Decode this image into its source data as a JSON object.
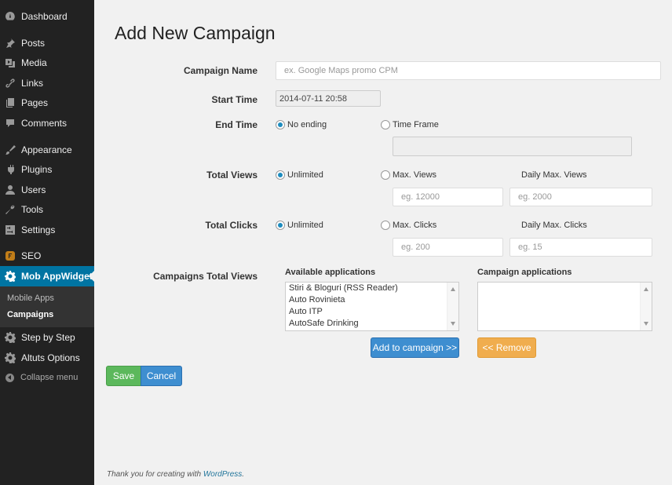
{
  "sidebar": {
    "items": [
      {
        "label": "Dashboard",
        "icon": "dashboard-icon"
      },
      {
        "label": "Posts",
        "icon": "pin-icon"
      },
      {
        "label": "Media",
        "icon": "media-icon"
      },
      {
        "label": "Links",
        "icon": "link-icon"
      },
      {
        "label": "Pages",
        "icon": "pages-icon"
      },
      {
        "label": "Comments",
        "icon": "comment-icon"
      },
      {
        "label": "Appearance",
        "icon": "brush-icon"
      },
      {
        "label": "Plugins",
        "icon": "plugin-icon"
      },
      {
        "label": "Users",
        "icon": "user-icon"
      },
      {
        "label": "Tools",
        "icon": "wrench-icon"
      },
      {
        "label": "Settings",
        "icon": "settings-icon"
      },
      {
        "label": "SEO",
        "icon": "seo-icon"
      },
      {
        "label": "Mob AppWidget",
        "icon": "gear-icon"
      },
      {
        "label": "Step by Step",
        "icon": "gear-icon"
      },
      {
        "label": "Altuts Options",
        "icon": "gear-icon"
      }
    ],
    "submenu": [
      "Mobile Apps",
      "Campaigns"
    ],
    "collapse_label": "Collapse menu"
  },
  "page": {
    "title": "Add New Campaign"
  },
  "form": {
    "campaign_name_label": "Campaign Name",
    "campaign_name_placeholder": "ex. Google Maps promo CPM",
    "start_time_label": "Start Time",
    "start_time_value": "2014-07-11 20:58",
    "end_time_label": "End Time",
    "end_no_ending": "No ending",
    "end_time_frame": "Time Frame",
    "total_views_label": "Total Views",
    "views_unlimited": "Unlimited",
    "views_max": "Max. Views",
    "views_daily_max": "Daily Max. Views",
    "views_max_placeholder": "eg. 12000",
    "views_daily_placeholder": "eg. 2000",
    "total_clicks_label": "Total Clicks",
    "clicks_unlimited": "Unlimited",
    "clicks_max": "Max. Clicks",
    "clicks_daily_max": "Daily Max. Clicks",
    "clicks_max_placeholder": "eg. 200",
    "clicks_daily_placeholder": "eg. 15",
    "campaigns_total_views_label": "Campaigns Total Views",
    "available_apps_header": "Available applications",
    "available_apps": [
      "Stiri & Bloguri (RSS Reader)",
      "Auto Rovinieta",
      "Auto ITP",
      "AutoSafe Drinking"
    ],
    "campaign_apps_header": "Campaign applications",
    "add_button": "Add to campaign >>",
    "remove_button": "<< Remove",
    "save_button": "Save",
    "cancel_button": "Cancel"
  },
  "footer": {
    "text": "Thank you for creating with ",
    "link": "WordPress",
    "suffix": "."
  },
  "colors": {
    "sidebar_bg": "#222222",
    "active_menu": "#0074a2",
    "radio_selected": "#1e8cbe",
    "blue_button": "#3e8ed0",
    "orange_button": "#f0ad4e",
    "green_button": "#5cb85c"
  }
}
